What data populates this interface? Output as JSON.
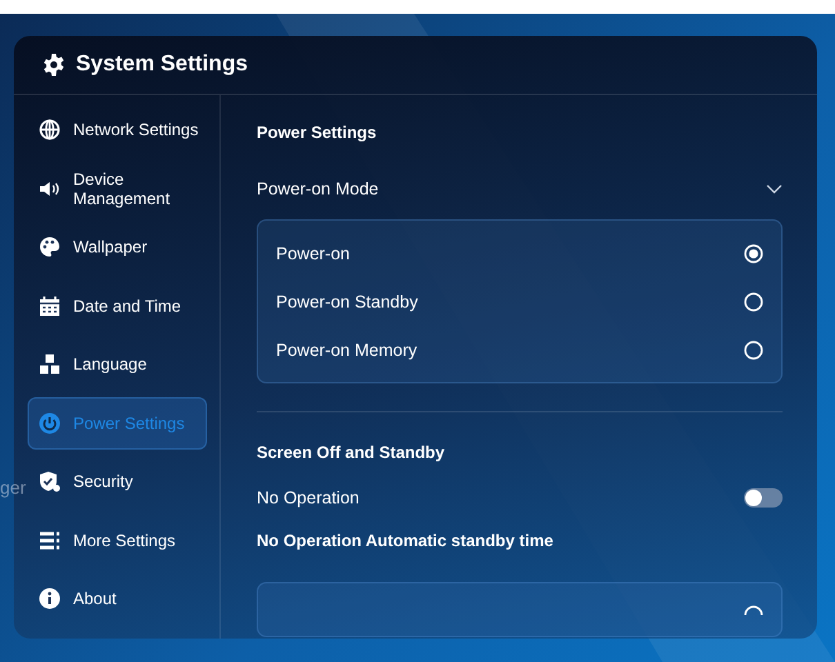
{
  "window": {
    "title": "System Settings"
  },
  "background_label": "ger",
  "sidebar": {
    "items": [
      {
        "label": "Network Settings",
        "selected": false
      },
      {
        "label": "Device Management",
        "selected": false
      },
      {
        "label": "Wallpaper",
        "selected": false
      },
      {
        "label": "Date and Time",
        "selected": false
      },
      {
        "label": "Language",
        "selected": false
      },
      {
        "label": "Power Settings",
        "selected": true
      },
      {
        "label": "Security",
        "selected": false
      },
      {
        "label": "More Settings",
        "selected": false
      },
      {
        "label": "About",
        "selected": false
      }
    ]
  },
  "content": {
    "title": "Power Settings",
    "power_on_mode": {
      "label": "Power-on Mode",
      "expanded": true,
      "options": [
        {
          "label": "Power-on",
          "selected": true
        },
        {
          "label": "Power-on Standby",
          "selected": false
        },
        {
          "label": "Power-on Memory",
          "selected": false
        }
      ]
    },
    "standby_title": "Screen Off and Standby",
    "no_operation": {
      "label": "No Operation",
      "on": false
    },
    "standby_time_title": "No Operation Automatic standby time",
    "standby_time_option": {
      "selected": false
    }
  }
}
